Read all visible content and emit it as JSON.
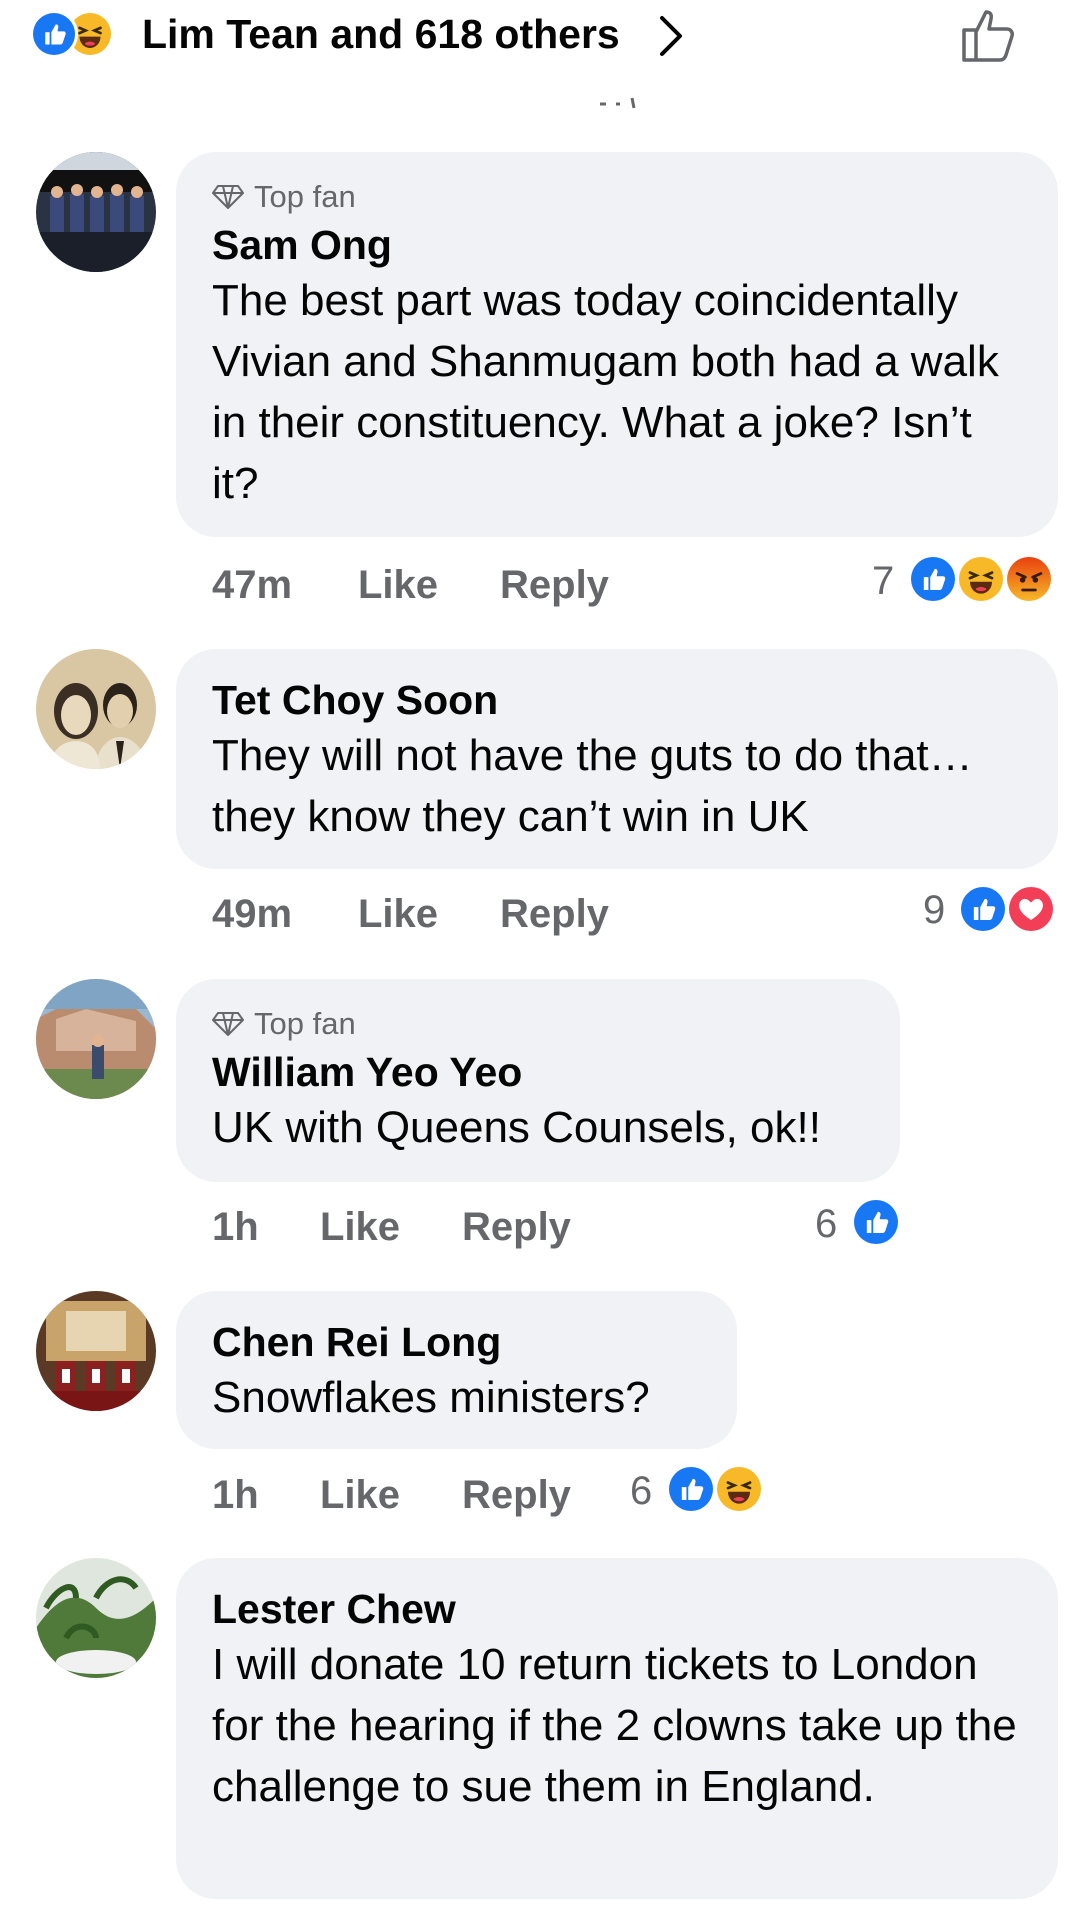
{
  "header": {
    "reactions": [
      "like-icon",
      "haha-icon"
    ],
    "text": "Lim Tean and 618 others"
  },
  "comments": [
    {
      "top_fan": "Top fan",
      "name": "Sam Ong",
      "text": "The best part was today coincidentally Vivian and Shanmugam both had a walk in their constituency. What a joke? Isn’t it?",
      "time": "47m",
      "like": "Like",
      "reply": "Reply",
      "reaction_count": "7",
      "reactions": [
        "like-icon",
        "haha-icon",
        "angry-icon"
      ]
    },
    {
      "top_fan": "",
      "name": "Tet Choy Soon",
      "text": "They will not have the guts to do that… they know they can’t win in UK",
      "time": "49m",
      "like": "Like",
      "reply": "Reply",
      "reaction_count": "9",
      "reactions": [
        "like-icon",
        "love-icon"
      ]
    },
    {
      "top_fan": "Top fan",
      "name": "William Yeo Yeo",
      "text": "UK with Queens Counsels, ok!!",
      "time": "1h",
      "like": "Like",
      "reply": "Reply",
      "reaction_count": "6",
      "reactions": [
        "like-icon"
      ]
    },
    {
      "top_fan": "",
      "name": "Chen Rei Long",
      "text": "Snowflakes ministers?",
      "time": "1h",
      "like": "Like",
      "reply": "Reply",
      "reaction_count": "6",
      "reactions": [
        "like-icon",
        "haha-icon"
      ]
    },
    {
      "top_fan": "",
      "name": "Lester Chew",
      "text": "I will donate 10 return tickets to London for the hearing if the 2 clowns take up the challenge to sue them in England.",
      "time": "",
      "like": "",
      "reply": "",
      "reaction_count": "",
      "reactions": []
    }
  ],
  "colors": {
    "like_blue": "#1877f2",
    "haha_yellow": "#f7b928",
    "love_red": "#f33e58",
    "angry_orange": "#e9710f",
    "bubble_gray": "#f0f2f5",
    "meta_gray": "#65676b"
  }
}
